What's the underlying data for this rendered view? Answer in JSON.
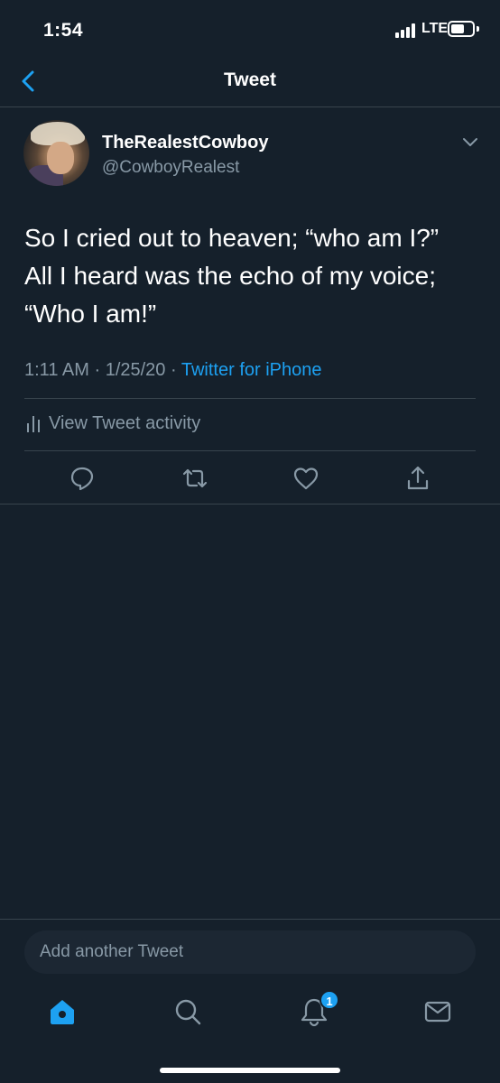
{
  "status_bar": {
    "time": "1:54",
    "network": "LTE"
  },
  "nav": {
    "title": "Tweet",
    "back_icon": "chevron-left-icon"
  },
  "tweet": {
    "display_name": "TheRealestCowboy",
    "handle": "@CowboyRealest",
    "text": "So I cried out to heaven; “who am I?”\nAll I heard was the echo of my voice;\n“Who I am!”",
    "time": "1:11 AM",
    "date": "1/25/20",
    "separator": "·",
    "source": "Twitter for iPhone",
    "activity_label": "View Tweet activity"
  },
  "actions": [
    "reply-icon",
    "retweet-icon",
    "like-icon",
    "share-icon"
  ],
  "compose": {
    "placeholder": "Add another Tweet"
  },
  "tabbar": {
    "items": [
      "home-icon",
      "search-icon",
      "notifications-icon",
      "messages-icon"
    ],
    "notification_count": "1"
  },
  "colors": {
    "background": "#15202b",
    "accent": "#1da1f2",
    "secondary_text": "#8899a6",
    "divider": "#38444d"
  }
}
